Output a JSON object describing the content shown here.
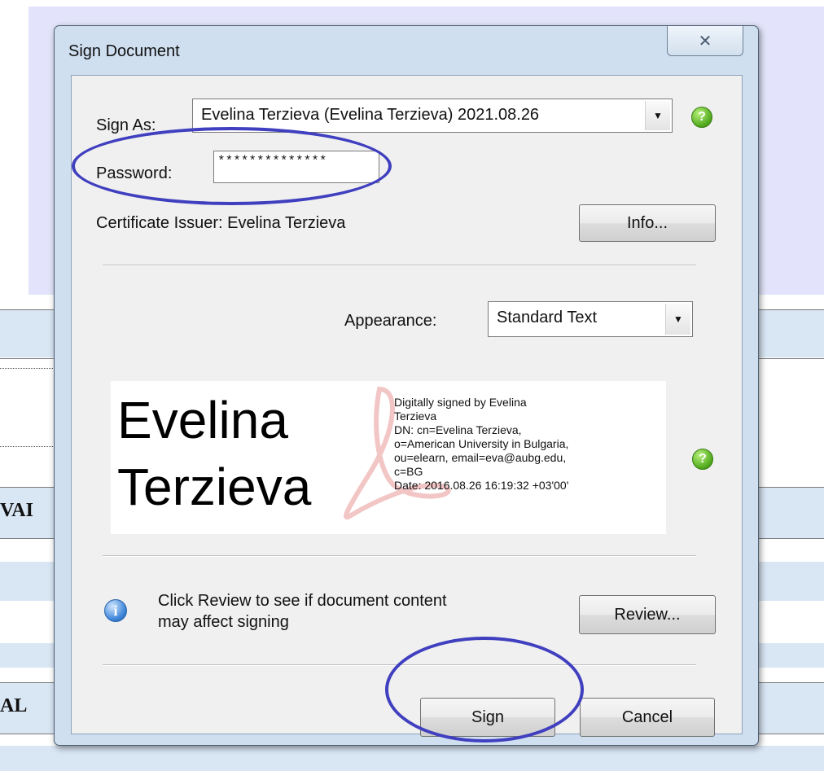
{
  "background_doc": {
    "fragment_1": "VAI",
    "fragment_2": "AL"
  },
  "dialog": {
    "title": "Sign Document",
    "close_glyph": "✕",
    "sign_as": {
      "label": "Sign As:",
      "value": "Evelina Terzieva (Evelina Terzieva) 2021.08.26",
      "arrow": "▼"
    },
    "password": {
      "label": "Password:",
      "value": "**************"
    },
    "certificate_issuer": "Certificate Issuer: Evelina Terzieva",
    "info_button": "Info...",
    "appearance": {
      "label": "Appearance:",
      "value": "Standard Text",
      "arrow": "▼"
    },
    "preview": {
      "name_line1": "Evelina",
      "name_line2": "Terzieva",
      "details": [
        "Digitally signed by Evelina",
        "Terzieva",
        "DN: cn=Evelina Terzieva,",
        "o=American University in Bulgaria,",
        "ou=elearn, email=eva@aubg.edu,",
        "c=BG",
        "Date: 2016.08.26 16:19:32 +03'00'"
      ]
    },
    "help_glyph": "?",
    "info_glyph": "i",
    "review": {
      "message_line1": "Click Review to see if document content",
      "message_line2": "may affect signing",
      "button": "Review..."
    },
    "sign_button": "Sign",
    "cancel_button": "Cancel"
  },
  "annotation_color": "#3f3fbf"
}
